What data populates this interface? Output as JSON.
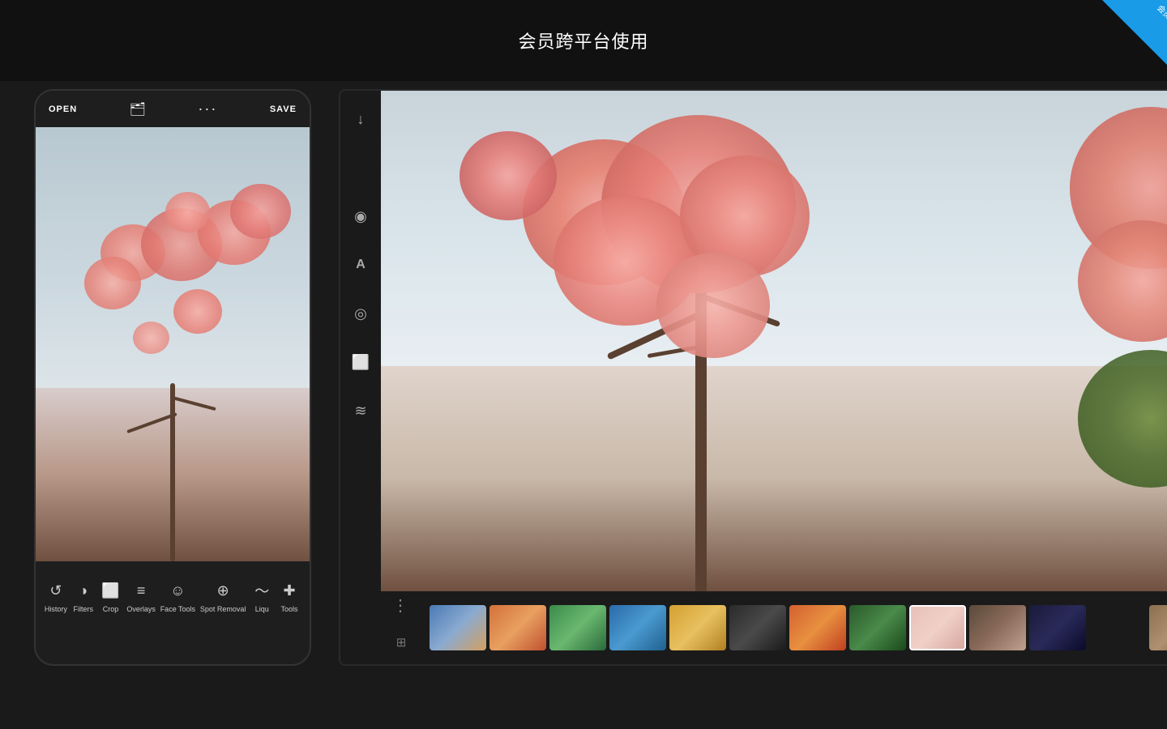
{
  "app": {
    "title": "会员跨平台使用",
    "corner_badge": "会员"
  },
  "phone": {
    "toolbar": {
      "open_label": "OPEN",
      "save_label": "SAVE"
    },
    "tools": [
      {
        "id": "history",
        "label": "History",
        "icon": "↺"
      },
      {
        "id": "filters",
        "label": "Filters",
        "icon": "◑"
      },
      {
        "id": "crop",
        "label": "Crop",
        "icon": "⬜"
      },
      {
        "id": "overlays",
        "label": "Overlays",
        "icon": "≡"
      },
      {
        "id": "face-tools",
        "label": "Face Tools",
        "icon": "☺"
      },
      {
        "id": "spot-removal",
        "label": "Spot Removal",
        "icon": "⊕"
      },
      {
        "id": "liqu",
        "label": "Liqu",
        "icon": "〜"
      },
      {
        "id": "tools",
        "label": "Tools",
        "icon": "✚"
      }
    ]
  },
  "tablet": {
    "sidebar_icons": [
      {
        "id": "download",
        "icon": "↓",
        "name": "download-icon"
      },
      {
        "id": "filter",
        "icon": "◉",
        "name": "filter-icon"
      },
      {
        "id": "text",
        "icon": "A",
        "name": "text-icon"
      },
      {
        "id": "mask",
        "icon": "◎",
        "name": "mask-icon"
      },
      {
        "id": "crop",
        "icon": "⬜",
        "name": "crop-icon"
      },
      {
        "id": "layers",
        "icon": "≋",
        "name": "layers-icon"
      }
    ],
    "bottom_icons": [
      {
        "id": "more",
        "icon": "⋮",
        "name": "more-icon"
      },
      {
        "id": "gallery",
        "icon": "⊞",
        "name": "gallery-icon"
      }
    ],
    "thumbnails": [
      {
        "id": 1,
        "theme": "city",
        "active": false
      },
      {
        "id": 2,
        "theme": "orange",
        "active": false
      },
      {
        "id": 3,
        "theme": "green",
        "active": false
      },
      {
        "id": 4,
        "theme": "blue",
        "active": false
      },
      {
        "id": 5,
        "theme": "yellow",
        "active": false
      },
      {
        "id": 6,
        "theme": "dark",
        "active": false
      },
      {
        "id": 7,
        "theme": "sunset",
        "active": false
      },
      {
        "id": 8,
        "theme": "forest",
        "active": false
      },
      {
        "id": 9,
        "theme": "blossom",
        "active": true
      },
      {
        "id": 10,
        "theme": "portrait",
        "active": false
      },
      {
        "id": 11,
        "theme": "night",
        "active": false
      },
      {
        "id": 12,
        "theme": "water",
        "active": false
      },
      {
        "id": 13,
        "theme": "ruins",
        "active": false
      },
      {
        "id": 14,
        "theme": "city",
        "active": false
      },
      {
        "id": 15,
        "theme": "sunset",
        "active": false
      },
      {
        "id": 16,
        "theme": "forest",
        "active": false
      },
      {
        "id": 17,
        "theme": "blue",
        "active": false
      }
    ]
  }
}
